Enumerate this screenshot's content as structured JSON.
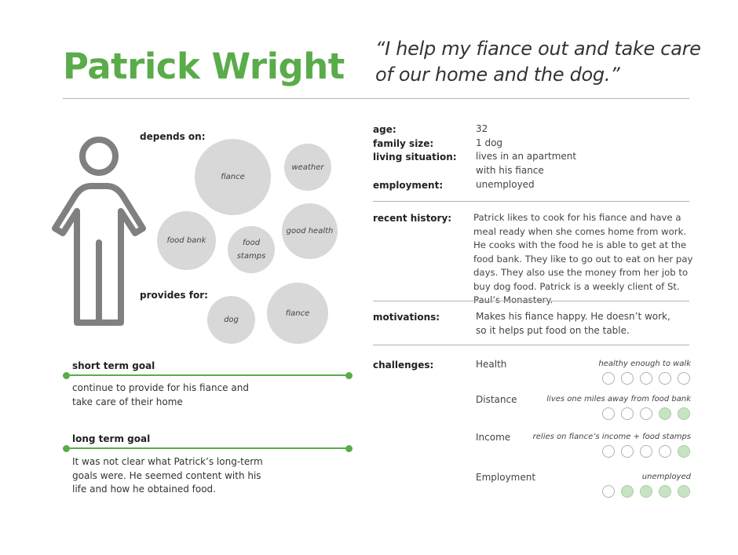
{
  "persona": {
    "name": "Patrick Wright",
    "quote": "“I help my fiance out and take care of our home and the dog.”",
    "accent_color": "#5aac4a"
  },
  "person_icon": "person-outline-icon",
  "depends_on": {
    "label": "depends on:",
    "items": [
      "fiance",
      "weather",
      "food bank",
      "food stamps",
      "good health"
    ]
  },
  "provides_for": {
    "label": "provides for:",
    "items": [
      "dog",
      "fiance"
    ]
  },
  "goals": {
    "short_term": {
      "title": "short term goal",
      "text": "continue to provide for his fiance and take care of their home"
    },
    "long_term": {
      "title": "long term goal",
      "text": "It was not clear what Patrick’s long-term goals were. He seemed content with his life and how he obtained food."
    }
  },
  "details": {
    "age_label": "age:",
    "age": "32",
    "family_label": "family size:",
    "family": "1 dog",
    "living_label": "living situation:",
    "living": "lives in an apartment with his fiance",
    "employment_label": "employment:",
    "employment": "unemployed"
  },
  "recent_history": {
    "label": "recent history:",
    "text": "Patrick likes to cook for his fiance and have a meal ready when she comes home from work. He cooks with the food he is able to get at the food bank. They like to go out to eat on her pay days. They also use the money from her job to buy dog food. Patrick is a weekly client of St. Paul’s Monastery."
  },
  "motivations": {
    "label": "motivations:",
    "text": "Makes his fiance happy. He doesn’t work, so it helps put food on the table."
  },
  "challenges": {
    "label": "challenges:",
    "scale_max": 5,
    "items": [
      {
        "name": "Health",
        "note": "healthy enough to walk",
        "level": 0
      },
      {
        "name": "Distance",
        "note": "lives one miles away from food bank",
        "level": 2
      },
      {
        "name": "Income",
        "note": "relies on fiance’s income + food stamps",
        "level": 1
      },
      {
        "name": "Employment",
        "note": "unemployed",
        "level": 4
      }
    ]
  }
}
